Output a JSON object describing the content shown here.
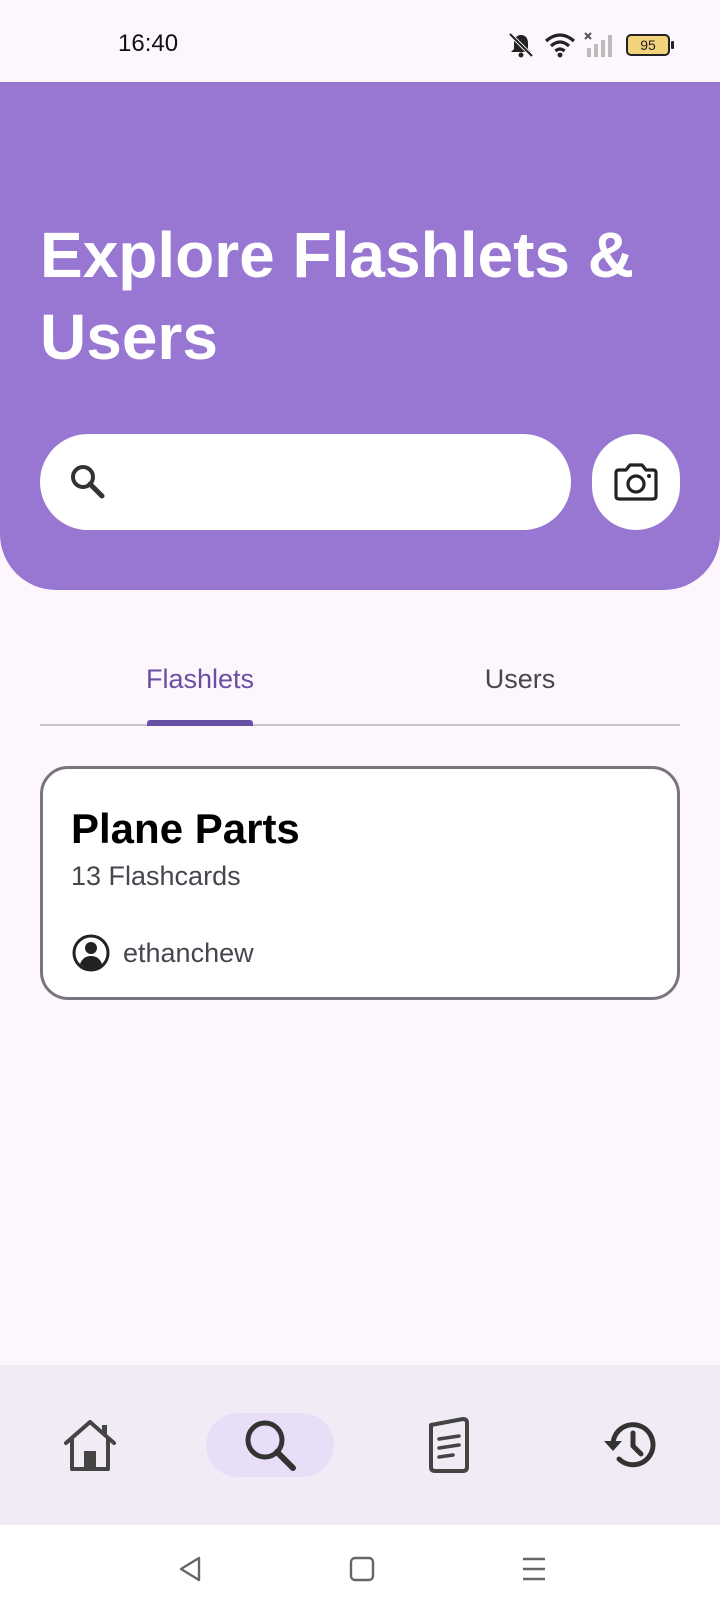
{
  "status_bar": {
    "time": "16:40",
    "battery_level": "95",
    "icons": [
      "mute-icon",
      "wifi-icon",
      "signal-icon",
      "battery-icon"
    ]
  },
  "header": {
    "title": "Explore Flashlets & Users",
    "background_color": "#9877D2"
  },
  "search": {
    "value": "",
    "placeholder": ""
  },
  "tabs": [
    {
      "label": "Flashlets",
      "selected": true
    },
    {
      "label": "Users",
      "selected": false
    }
  ],
  "results": [
    {
      "title": "Plane Parts",
      "count_text": "13 Flashcards",
      "username": "ethanchew"
    }
  ],
  "bottom_nav": {
    "items": [
      {
        "icon": "home-icon",
        "selected": false
      },
      {
        "icon": "search-icon",
        "selected": true
      },
      {
        "icon": "library-icon",
        "selected": false
      },
      {
        "icon": "history-icon",
        "selected": false
      }
    ]
  },
  "colors": {
    "accent": "#6750A4",
    "header": "#9877D2",
    "background": "#FDF6FD",
    "nav_background": "#F1EBF6",
    "nav_selected": "#E8DEF8"
  }
}
